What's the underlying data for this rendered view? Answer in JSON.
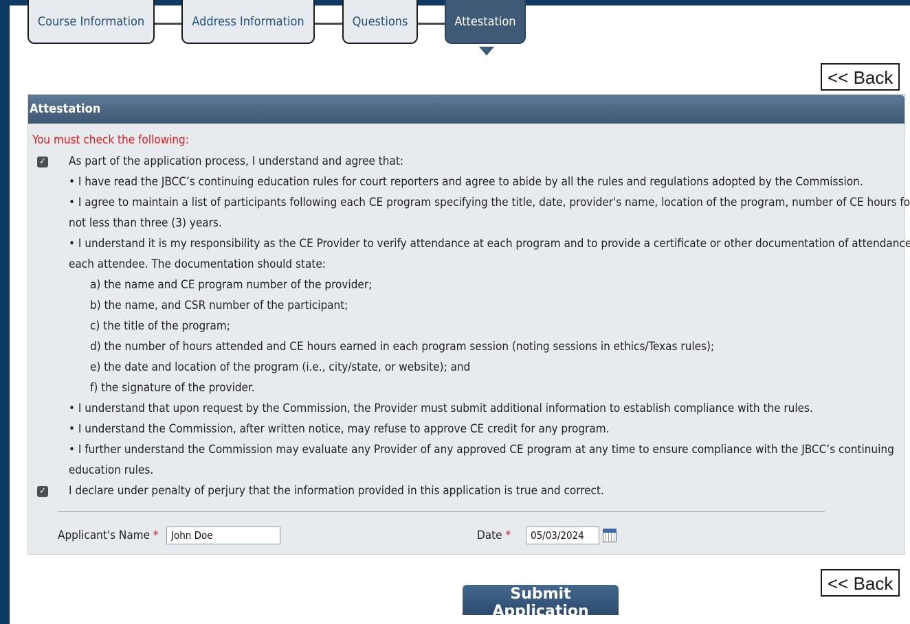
{
  "wizard": {
    "steps": [
      {
        "label": "Course Information"
      },
      {
        "label": "Address Information"
      },
      {
        "label": "Questions"
      },
      {
        "label": "Attestation"
      }
    ],
    "active_index": 3
  },
  "back_label": "<< Back",
  "panel": {
    "title": "Attestation",
    "warning": "You must check the following:",
    "items": [
      "As part of the application process, I understand and agree that:",
      "• I have read the JBCC’s continuing education rules for court reporters and agree to abide by all the rules and regulations adopted by the Commission.",
      "• I agree to maintain a list of participants following each CE program specifying the title, date, provider's name, location of the program, number of CE hours for",
      "not less than three (3) years.",
      "• I understand it is my responsibility as the CE Provider to verify attendance at each program and to provide a certificate or other documentation of attendance to",
      "each attendee. The documentation should state:",
      "a) the name and CE program number of the provider;",
      "b) the name, and CSR number of the participant;",
      "c) the title of the program;",
      "d) the number of hours attended and CE hours earned in each program session (noting sessions in ethics/Texas rules);",
      "e) the date and location of the program (i.e., city/state, or website); and",
      "f) the signature of the provider.",
      "• I understand that upon request by the Commission, the Provider must submit additional information to establish compliance with the rules.",
      "• I understand the Commission, after written notice, may refuse to approve CE credit for any program.",
      "• I further understand the Commission may evaluate any Provider of any approved CE program at any time to ensure compliance with the JBCC’s continuing",
      "education rules.",
      "I declare under penalty of perjury that the information provided in this application is true and correct."
    ],
    "checkbox_checked": [
      true,
      true
    ]
  },
  "form": {
    "name_label": "Applicant's Name",
    "name_value": "John Doe",
    "date_label": "Date",
    "date_value": "05/03/2024",
    "required_mark": "*"
  },
  "submit_label": "Submit Application"
}
